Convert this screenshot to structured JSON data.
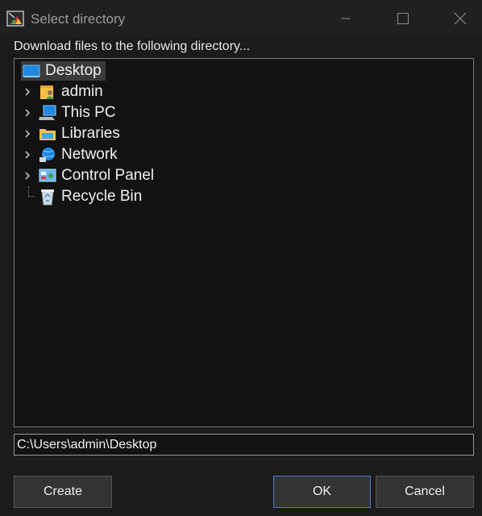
{
  "window": {
    "title": "Select directory"
  },
  "caption": "Download files to the following directory...",
  "tree": {
    "root": {
      "label": "Desktop",
      "icon": "desktop-icon",
      "selected": true
    },
    "children": [
      {
        "label": "admin",
        "icon": "user-folder-icon",
        "expandable": true
      },
      {
        "label": "This PC",
        "icon": "computer-icon",
        "expandable": true
      },
      {
        "label": "Libraries",
        "icon": "libraries-folder-icon",
        "expandable": true
      },
      {
        "label": "Network",
        "icon": "network-icon",
        "expandable": true
      },
      {
        "label": "Control Panel",
        "icon": "control-panel-icon",
        "expandable": true
      },
      {
        "label": "Recycle Bin",
        "icon": "recycle-bin-icon",
        "expandable": false
      }
    ]
  },
  "path": {
    "value": "C:\\Users\\admin\\Desktop"
  },
  "buttons": {
    "create": "Create",
    "ok": "OK",
    "cancel": "Cancel"
  },
  "colors": {
    "background": "#1b1b1b",
    "titlebar": "#202020",
    "tree_background": "#121212",
    "selection": "#3a3a3a",
    "ok_border": "#4a7bd0"
  }
}
